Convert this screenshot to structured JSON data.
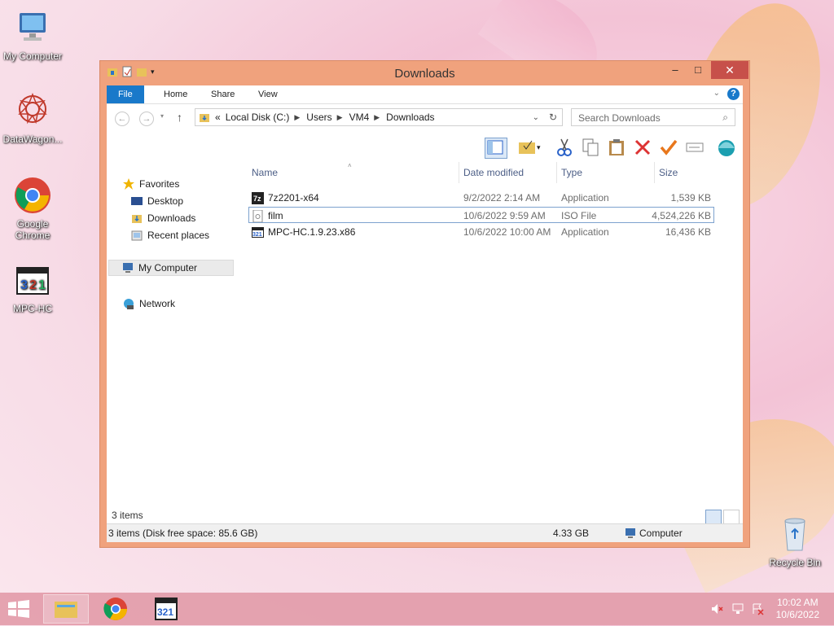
{
  "desktop": {
    "icons": [
      {
        "label": "My Computer",
        "icon": "my-computer-icon"
      },
      {
        "label": "DataWagon...",
        "icon": "datawagon-icon"
      },
      {
        "label": "Google Chrome",
        "icon": "chrome-icon"
      },
      {
        "label": "MPC-HC",
        "icon": "mpc-hc-icon"
      },
      {
        "label": "Recycle Bin",
        "icon": "recycle-bin-icon"
      }
    ]
  },
  "window": {
    "title": "Downloads",
    "controls": {
      "minimize": "–",
      "maximize": "□",
      "close": "✕"
    },
    "ribbon": {
      "tabs": [
        "File",
        "Home",
        "Share",
        "View"
      ],
      "help": "?"
    },
    "address": {
      "prefix": "«",
      "crumbs": [
        "Local Disk (C:)",
        "Users",
        "VM4",
        "Downloads"
      ]
    },
    "search_placeholder": "Search Downloads",
    "nav": {
      "favorites": "Favorites",
      "favorite_items": [
        "Desktop",
        "Downloads",
        "Recent places"
      ],
      "my_computer": "My Computer",
      "network": "Network"
    },
    "columns": [
      "Name",
      "Date modified",
      "Type",
      "Size"
    ],
    "files": [
      {
        "name": "7z2201-x64",
        "date": "9/2/2022 2:14 AM",
        "type": "Application",
        "size": "1,539 KB"
      },
      {
        "name": "film",
        "date": "10/6/2022 9:59 AM",
        "type": "ISO File",
        "size": "4,524,226 KB"
      },
      {
        "name": "MPC-HC.1.9.23.x86",
        "date": "10/6/2022 10:00 AM",
        "type": "Application",
        "size": "16,436 KB"
      }
    ],
    "item_count": "3 items",
    "status": {
      "left": "3 items (Disk free space: 85.6 GB)",
      "size": "4.33 GB",
      "location": "Computer"
    }
  },
  "taskbar": {
    "time": "10:02 AM",
    "date": "10/6/2022"
  },
  "colors": {
    "window_border": "#f0a27d",
    "file_tab": "#1979ca",
    "close_button": "#c7504a",
    "taskbar": "#e196a5"
  }
}
